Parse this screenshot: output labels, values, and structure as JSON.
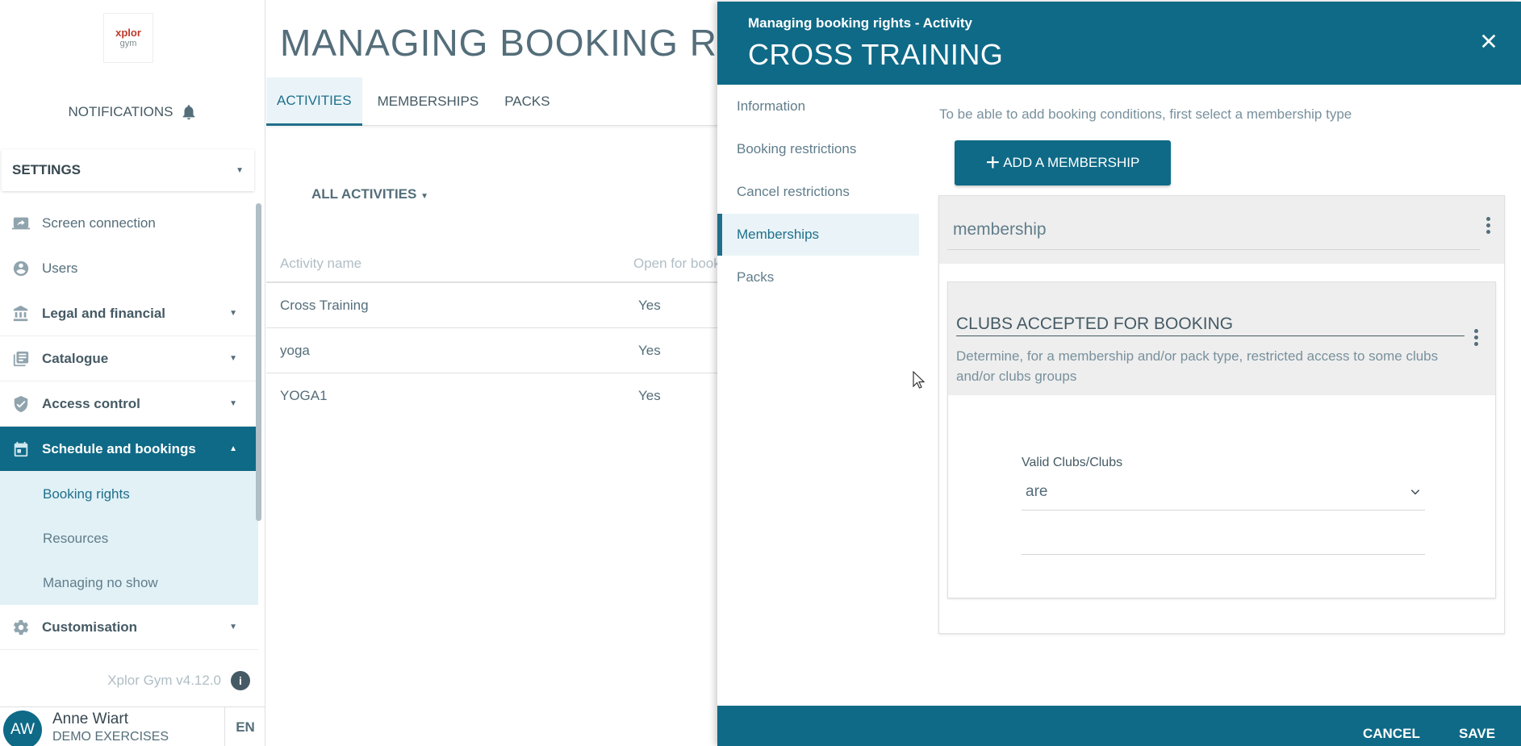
{
  "sidebar": {
    "logo": {
      "line1": "xplor",
      "line2": "gym"
    },
    "notifications_label": "NOTIFICATIONS",
    "settings_label": "SETTINGS",
    "menu": [
      {
        "label": "Screen connection",
        "icon": "screen-connection-icon"
      },
      {
        "label": "Users",
        "icon": "user-icon"
      },
      {
        "label": "Legal and financial",
        "icon": "bank-icon"
      },
      {
        "label": "Catalogue",
        "icon": "catalogue-icon"
      },
      {
        "label": "Access control",
        "icon": "shield-icon"
      },
      {
        "label": "Schedule and bookings",
        "icon": "calendar-icon"
      },
      {
        "label": "Customisation",
        "icon": "gear-icon"
      }
    ],
    "submenu": [
      "Booking rights",
      "Resources",
      "Managing no show"
    ],
    "version": "Xplor Gym v4.12.0",
    "version_info": "i",
    "user": {
      "initials": "AW",
      "name": "Anne Wiart",
      "org": "DEMO EXERCISES",
      "lang": "EN"
    }
  },
  "main": {
    "title": "MANAGING BOOKING RIGHTS",
    "tabs": [
      "ACTIVITIES",
      "MEMBERSHIPS",
      "PACKS"
    ],
    "filter_label": "ALL ACTIVITIES",
    "columns": [
      "Activity name",
      "Open for booking"
    ],
    "rows": [
      {
        "name": "Cross Training",
        "open": "Yes"
      },
      {
        "name": "yoga",
        "open": "Yes"
      },
      {
        "name": "YOGA1",
        "open": "Yes"
      }
    ]
  },
  "panel": {
    "subtitle": "Managing booking rights - Activity",
    "title": "CROSS TRAINING",
    "nav": [
      "Information",
      "Booking restrictions",
      "Cancel restrictions",
      "Memberships",
      "Packs"
    ],
    "hint": "To be able to add booking conditions, first select a membership type",
    "add_button": "ADD A MEMBERSHIP",
    "membership_label": "membership",
    "clubs_card": {
      "title": "CLUBS ACCEPTED FOR BOOKING",
      "description": "Determine, for a membership and/or pack type, restricted access to some clubs and/or clubs groups",
      "select_label": "Valid Clubs/Clubs",
      "select_value": "are"
    },
    "footer": {
      "cancel": "CANCEL",
      "save": "SAVE"
    }
  },
  "colors": {
    "primary": "#0f6a87",
    "submenu_bg": "#e1f1f6",
    "text": "#546e7a"
  }
}
